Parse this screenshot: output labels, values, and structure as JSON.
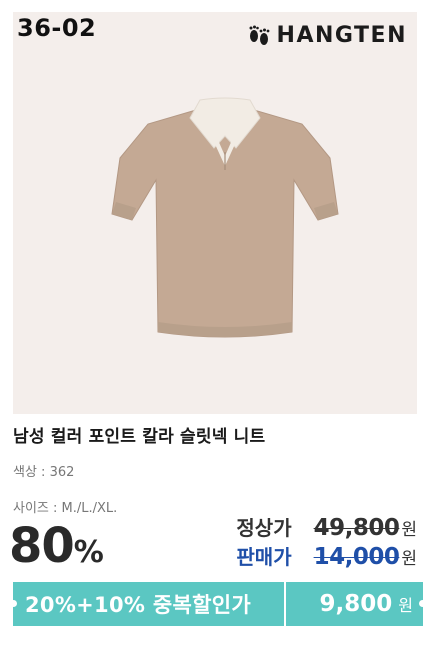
{
  "card": {
    "code": "36-02",
    "brand": {
      "name": "HANGTEN",
      "logo_icon": "footprints-icon"
    },
    "product": {
      "name": "남성 컬러 포인트 칼라 슬릿넥 니트",
      "color_line": "색상 : 362",
      "size_line": "사이즈 : M./L./XL."
    },
    "discount": {
      "value": "80",
      "unit": "%"
    },
    "prices": {
      "regular_label": "정상가",
      "regular_value": "49,800",
      "sale_label": "판매가",
      "sale_value": "14,000",
      "currency": "원"
    },
    "banner": {
      "promo_text": "20%+10% 중복할인가",
      "final_price": "9,800",
      "currency": "원"
    },
    "colors": {
      "sale_blue": "#1f4fa8",
      "banner_teal": "#5bc7c2",
      "image_bg": "#f4eeeb",
      "shirt_body": "#c4a994"
    }
  }
}
